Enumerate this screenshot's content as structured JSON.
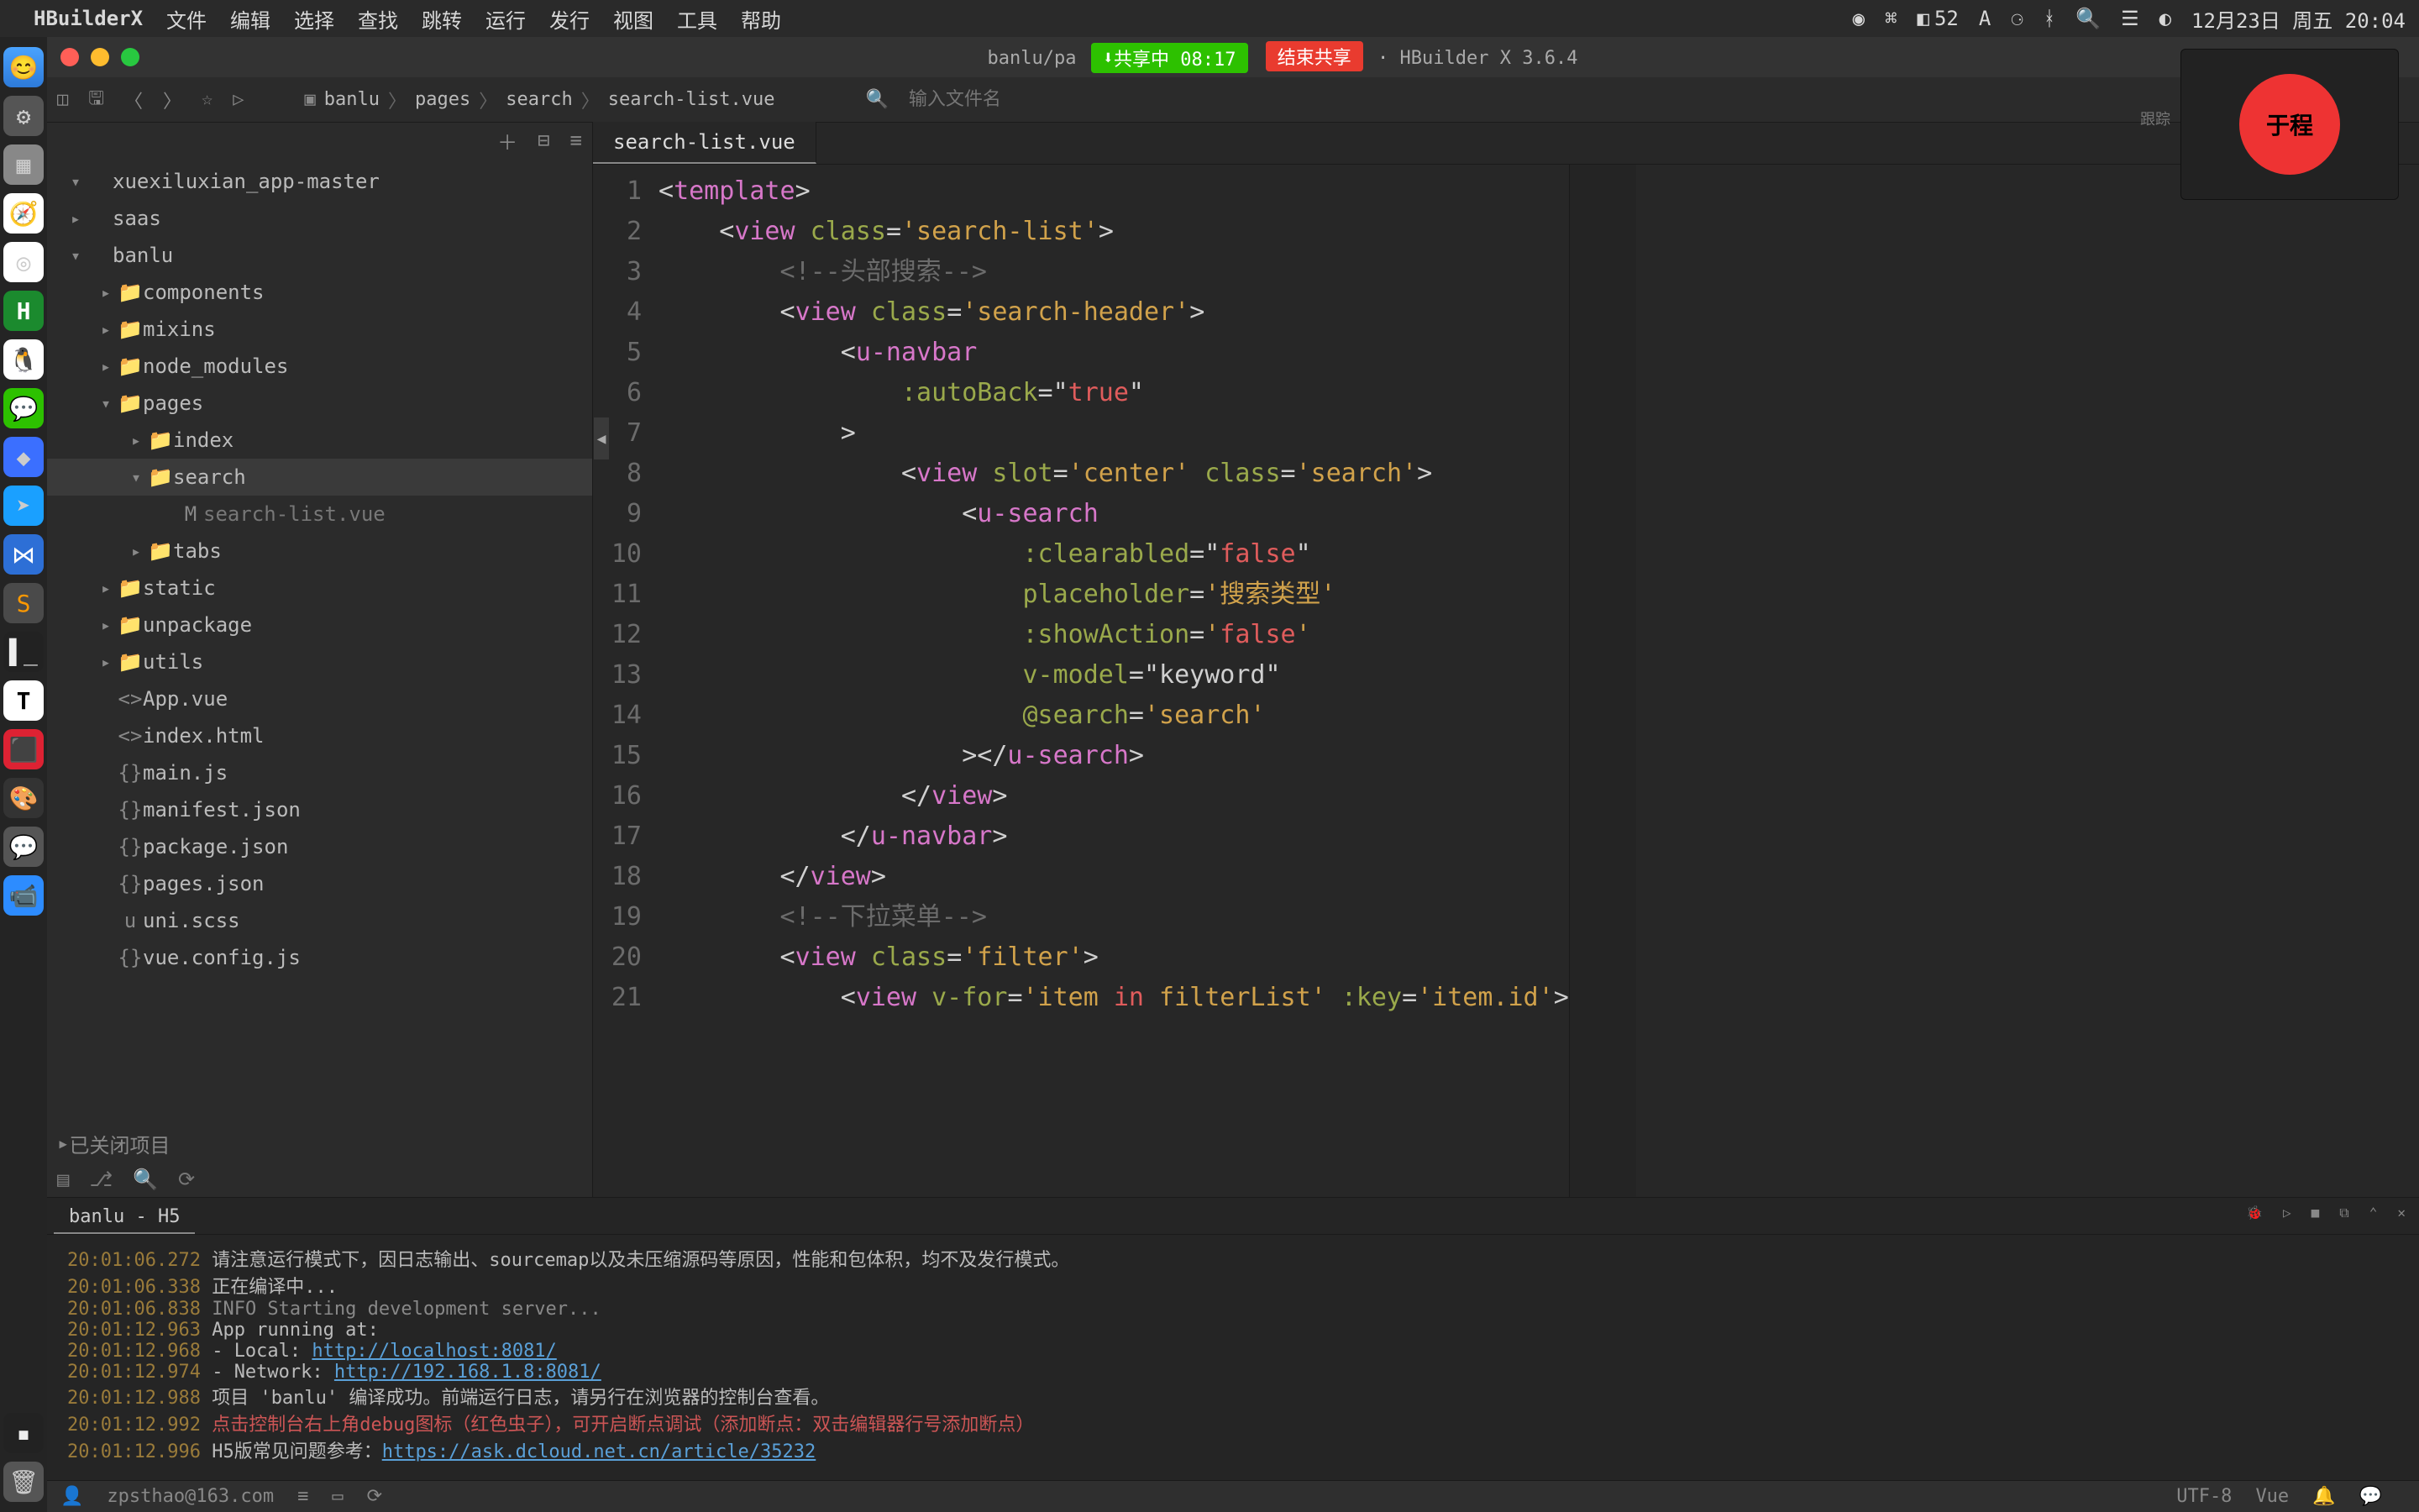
{
  "menubar": {
    "app": "HBuilderX",
    "items": [
      "文件",
      "编辑",
      "选择",
      "查找",
      "跳转",
      "运行",
      "发行",
      "视图",
      "工具",
      "帮助"
    ],
    "battery_num": "52",
    "clock": "12月23日 周五 20:04"
  },
  "titlebar": {
    "path_left": "banlu/pa",
    "share_on": "共享中 08:17",
    "share_end": "结束共享",
    "app_version": "HBuilder X 3.6.4"
  },
  "toolbar": {
    "breadcrumb": [
      "banlu",
      "pages",
      "search",
      "search-list.vue"
    ],
    "search_placeholder": "输入文件名"
  },
  "overlay": {
    "avatar_text": "于程",
    "label1": "",
    "label2": "跟踪"
  },
  "sidebar": {
    "tree": [
      {
        "depth": 0,
        "caret": "▾",
        "icon": "",
        "label": "xuexiluxian_app-master"
      },
      {
        "depth": 0,
        "caret": "▸",
        "icon": "",
        "label": "saas"
      },
      {
        "depth": 0,
        "caret": "▾",
        "icon": "",
        "label": "banlu"
      },
      {
        "depth": 1,
        "caret": "▸",
        "icon": "📁",
        "label": "components"
      },
      {
        "depth": 1,
        "caret": "▸",
        "icon": "📁",
        "label": "mixins"
      },
      {
        "depth": 1,
        "caret": "▸",
        "icon": "📁",
        "label": "node_modules"
      },
      {
        "depth": 1,
        "caret": "▾",
        "icon": "📁",
        "label": "pages"
      },
      {
        "depth": 2,
        "caret": "▸",
        "icon": "📁",
        "label": "index"
      },
      {
        "depth": 2,
        "caret": "▾",
        "icon": "📁",
        "label": "search",
        "selected": true
      },
      {
        "depth": 3,
        "caret": "",
        "icon": "M",
        "label": "search-list.vue",
        "muted": true
      },
      {
        "depth": 2,
        "caret": "▸",
        "icon": "📁",
        "label": "tabs"
      },
      {
        "depth": 1,
        "caret": "▸",
        "icon": "📁",
        "label": "static"
      },
      {
        "depth": 1,
        "caret": "▸",
        "icon": "📁",
        "label": "unpackage"
      },
      {
        "depth": 1,
        "caret": "▸",
        "icon": "📁",
        "label": "utils"
      },
      {
        "depth": 1,
        "caret": "",
        "icon": "<>",
        "label": "App.vue"
      },
      {
        "depth": 1,
        "caret": "",
        "icon": "<>",
        "label": "index.html"
      },
      {
        "depth": 1,
        "caret": "",
        "icon": "{}",
        "label": "main.js"
      },
      {
        "depth": 1,
        "caret": "",
        "icon": "{}",
        "label": "manifest.json"
      },
      {
        "depth": 1,
        "caret": "",
        "icon": "{}",
        "label": "package.json"
      },
      {
        "depth": 1,
        "caret": "",
        "icon": "{}",
        "label": "pages.json"
      },
      {
        "depth": 1,
        "caret": "",
        "icon": "u",
        "label": "uni.scss"
      },
      {
        "depth": 1,
        "caret": "",
        "icon": "{}",
        "label": "vue.config.js"
      }
    ],
    "closed_projects": "已关闭项目"
  },
  "editor": {
    "tab": "search-list.vue",
    "lines": [
      {
        "n": 1,
        "html": "<span class='tk-w'>&lt;</span><span class='tk-p'>template</span><span class='tk-w'>&gt;</span>"
      },
      {
        "n": 2,
        "html": "    <span class='tk-w'>&lt;</span><span class='tk-p'>view</span> <span class='tk-g'>class</span><span class='tk-w'>=</span><span class='tk-y'>'search-list'</span><span class='tk-w'>&gt;</span>"
      },
      {
        "n": 3,
        "html": "        <span class='tk-c'>&lt;!--头部搜索--&gt;</span>"
      },
      {
        "n": 4,
        "html": "        <span class='tk-w'>&lt;</span><span class='tk-p'>view</span> <span class='tk-g'>class</span><span class='tk-w'>=</span><span class='tk-y'>'search-header'</span><span class='tk-w'>&gt;</span>"
      },
      {
        "n": 5,
        "html": "            <span class='tk-w'>&lt;</span><span class='tk-p'>u-navbar</span>"
      },
      {
        "n": 6,
        "html": "                <span class='tk-g'>:autoBack</span><span class='tk-w'>=</span><span class='tk-w'>\"</span><span class='tk-red'>true</span><span class='tk-w'>\"</span>"
      },
      {
        "n": 7,
        "html": "            <span class='tk-w'>&gt;</span>"
      },
      {
        "n": 8,
        "html": "                <span class='tk-w'>&lt;</span><span class='tk-p'>view</span> <span class='tk-g'>slot</span><span class='tk-w'>=</span><span class='tk-y'>'center'</span> <span class='tk-g'>class</span><span class='tk-w'>=</span><span class='tk-y'>'search'</span><span class='tk-w'>&gt;</span>"
      },
      {
        "n": 9,
        "html": "                    <span class='tk-w'>&lt;</span><span class='tk-p'>u-search</span>"
      },
      {
        "n": 10,
        "html": "                        <span class='tk-g'>:clearabled</span><span class='tk-w'>=</span><span class='tk-w'>\"</span><span class='tk-red'>false</span><span class='tk-w'>\"</span>"
      },
      {
        "n": 11,
        "html": "                        <span class='tk-g'>placeholder</span><span class='tk-w'>=</span><span class='tk-y'>'搜索类型'</span>"
      },
      {
        "n": 12,
        "html": "                        <span class='tk-g'>:showAction</span><span class='tk-w'>=</span><span class='tk-y'>'</span><span class='tk-red'>false</span><span class='tk-y'>'</span>"
      },
      {
        "n": 13,
        "html": "                        <span class='tk-g'>v-model</span><span class='tk-w'>=</span><span class='tk-w'>\"</span><span class='tk-w'>keyword</span><span class='tk-w'>\"</span>"
      },
      {
        "n": 14,
        "html": "                        <span class='tk-g'>@search</span><span class='tk-w'>=</span><span class='tk-y'>'search'</span>"
      },
      {
        "n": 15,
        "html": "                    <span class='tk-w'>&gt;&lt;/</span><span class='tk-p'>u-search</span><span class='tk-w'>&gt;</span>"
      },
      {
        "n": 16,
        "html": "                <span class='tk-w'>&lt;/</span><span class='tk-p'>view</span><span class='tk-w'>&gt;</span>"
      },
      {
        "n": 17,
        "html": "            <span class='tk-w'>&lt;/</span><span class='tk-p'>u-navbar</span><span class='tk-w'>&gt;</span>"
      },
      {
        "n": 18,
        "html": "        <span class='tk-w'>&lt;/</span><span class='tk-p'>view</span><span class='tk-w'>&gt;</span>"
      },
      {
        "n": 19,
        "html": "        <span class='tk-c'>&lt;!--下拉菜单--&gt;</span>"
      },
      {
        "n": 20,
        "html": "        <span class='tk-w'>&lt;</span><span class='tk-p'>view</span> <span class='tk-g'>class</span><span class='tk-w'>=</span><span class='tk-y'>'filter'</span><span class='tk-w'>&gt;</span>"
      },
      {
        "n": 21,
        "html": "            <span class='tk-w'>&lt;</span><span class='tk-p'>view</span> <span class='tk-g'>v-for</span><span class='tk-w'>=</span><span class='tk-y'>'item </span><span class='tk-red'>in</span><span class='tk-y'> filterList'</span> <span class='tk-g'>:key</span><span class='tk-w'>=</span><span class='tk-y'>'item.id'</span><span class='tk-w'>&gt;</span>"
      }
    ]
  },
  "console": {
    "tab": "banlu - H5",
    "lines": [
      {
        "ts": "20:01:06.272",
        "body": "请注意运行模式下，因日志输出、sourcemap以及未压缩源码等原因，性能和包体积，均不及发行模式。"
      },
      {
        "ts": "20:01:06.338",
        "body": "正在编译中..."
      },
      {
        "ts": "20:01:06.838",
        "body": "INFO  Starting development server...",
        "info": true
      },
      {
        "ts": "20:01:12.963",
        "body": "  App running at:"
      },
      {
        "ts": "20:01:12.968",
        "body": "  - Local:   ",
        "link": "http://localhost:8081/"
      },
      {
        "ts": "20:01:12.974",
        "body": "  - Network: ",
        "link": "http://192.168.1.8:8081/"
      },
      {
        "ts": "20:01:12.988",
        "body": "项目 'banlu' 编译成功。前端运行日志，请另行在浏览器的控制台查看。"
      },
      {
        "ts": "20:01:12.992",
        "body": "点击控制台右上角debug图标（红色虫子），可开启断点调试（添加断点：双击编辑器行号添加断点）",
        "color": "#c55"
      },
      {
        "ts": "20:01:12.996",
        "body": "H5版常见问题参考：",
        "link": "https://ask.dcloud.net.cn/article/35232"
      }
    ]
  },
  "statusbar": {
    "user": "zpsthao@163.com",
    "encoding": "UTF-8",
    "lang": "Vue"
  }
}
